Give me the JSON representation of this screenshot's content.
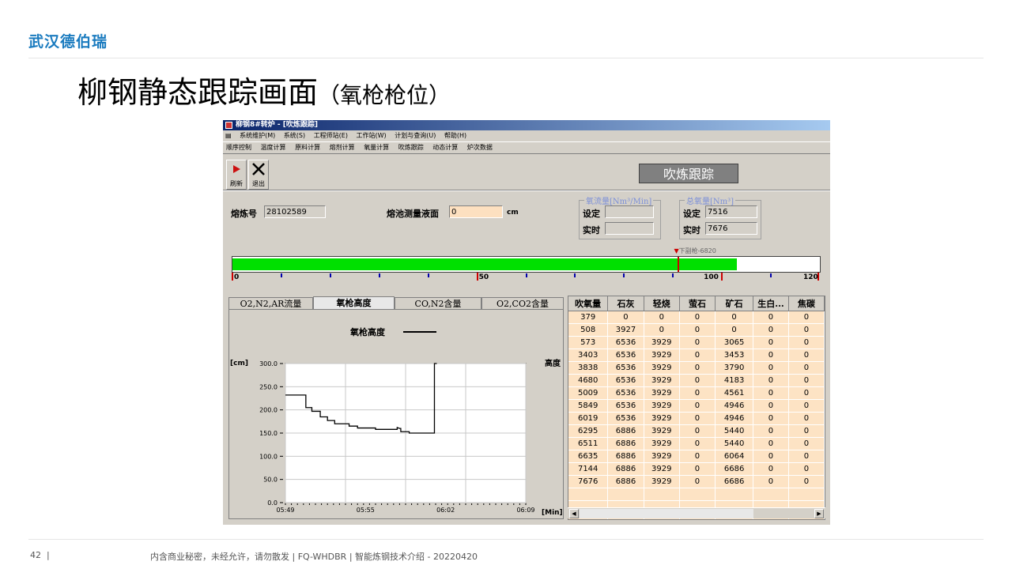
{
  "slide": {
    "brand": "武汉德伯瑞",
    "title": "柳钢静态跟踪画面",
    "subtitle": "（氧枪枪位）",
    "page_number": "42",
    "page_sep": "|",
    "footer": "内含商业秘密，未经允许，请勿散发 | FQ-WHDBR | 智能炼钢技术介绍 - 20220420"
  },
  "app": {
    "title": "柳钢8#转炉 - [吹炼跟踪]",
    "menu": [
      "系统维护(M)",
      "系统(S)",
      "工程师站(E)",
      "工作站(W)",
      "计划与查询(U)",
      "帮助(H)"
    ],
    "nav": [
      "顺序控制",
      "温度计算",
      "原料计算",
      "熔剂计算",
      "氧量计算",
      "吹炼跟踪",
      "动态计算",
      "炉次数据"
    ],
    "buttons": {
      "refresh": "刷新",
      "exit": "退出"
    },
    "banner": "吹炼跟踪",
    "heat_label": "熔炼号",
    "heat_value": "28102589",
    "bath_label": "熔池测量液面",
    "bath_value": "0",
    "bath_unit": "cm",
    "oxy_flow": {
      "caption": "氧流量[Nm³/Min]",
      "set_label": "设定",
      "set_value": "",
      "act_label": "实时",
      "act_value": ""
    },
    "oxy_total": {
      "caption": "总氧量[Nm³]",
      "set_label": "设定",
      "set_value": "7516",
      "act_label": "实时",
      "act_value": "7676"
    },
    "progress": {
      "value": 103.0,
      "max": 120,
      "marker_label": "下副枪-6820",
      "marker_value": 91.0,
      "scale_labels": [
        "0",
        "50",
        "100",
        "120"
      ],
      "fill_color": "#00e000",
      "marker_color": "#cc0000"
    },
    "tabs": [
      "O2,N2,AR流量",
      "氧枪高度",
      "CO,N2含量",
      "O2,CO2含量"
    ],
    "active_tab": 1,
    "legend_label": "氧枪高度",
    "table": {
      "columns": [
        "吹氧量",
        "石灰",
        "轻烧",
        "萤石",
        "矿石",
        "生白...",
        "焦碳"
      ],
      "rows": [
        [
          "379",
          "0",
          "0",
          "0",
          "0",
          "0",
          "0"
        ],
        [
          "508",
          "3927",
          "0",
          "0",
          "0",
          "0",
          "0"
        ],
        [
          "573",
          "6536",
          "3929",
          "0",
          "3065",
          "0",
          "0"
        ],
        [
          "3403",
          "6536",
          "3929",
          "0",
          "3453",
          "0",
          "0"
        ],
        [
          "3838",
          "6536",
          "3929",
          "0",
          "3790",
          "0",
          "0"
        ],
        [
          "4680",
          "6536",
          "3929",
          "0",
          "4183",
          "0",
          "0"
        ],
        [
          "5009",
          "6536",
          "3929",
          "0",
          "4561",
          "0",
          "0"
        ],
        [
          "5849",
          "6536",
          "3929",
          "0",
          "4946",
          "0",
          "0"
        ],
        [
          "6019",
          "6536",
          "3929",
          "0",
          "4946",
          "0",
          "0"
        ],
        [
          "6295",
          "6886",
          "3929",
          "0",
          "5440",
          "0",
          "0"
        ],
        [
          "6511",
          "6886",
          "3929",
          "0",
          "5440",
          "0",
          "0"
        ],
        [
          "6635",
          "6886",
          "3929",
          "0",
          "6064",
          "0",
          "0"
        ],
        [
          "7144",
          "6886",
          "3929",
          "0",
          "6686",
          "0",
          "0"
        ],
        [
          "7676",
          "6886",
          "3929",
          "0",
          "6686",
          "0",
          "0"
        ]
      ]
    }
  },
  "chart_data": {
    "type": "line",
    "title": "",
    "ylabel": "[cm]",
    "xlabel": "[Min]",
    "right_label": "高度",
    "series": [
      {
        "name": "氧枪高度",
        "color": "#000000"
      }
    ],
    "x": [
      0,
      0.4,
      1.7,
      1.7,
      2.2,
      2.2,
      2.9,
      2.9,
      3.5,
      3.5,
      4.1,
      4.1,
      5.3,
      5.3,
      6.0,
      6.0,
      7.5,
      7.5,
      9.3,
      9.3,
      9.5,
      9.6,
      9.6,
      10.3,
      10.3,
      12.4,
      12.4,
      12.6
    ],
    "y": [
      232,
      232,
      232,
      205,
      205,
      197,
      197,
      185,
      185,
      177,
      177,
      170,
      170,
      165,
      165,
      161,
      161,
      158,
      158,
      162,
      160,
      160,
      153,
      153,
      150,
      150,
      300,
      300
    ],
    "xlim": [
      0,
      20
    ],
    "ylim": [
      0,
      300
    ],
    "xticks": [
      "05:49",
      "05:55",
      "06:02",
      "06:09"
    ],
    "yticks": [
      "0.0",
      "50.0",
      "100.0",
      "150.0",
      "200.0",
      "250.0",
      "300.0"
    ]
  }
}
